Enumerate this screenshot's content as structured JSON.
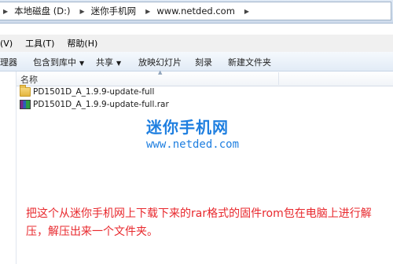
{
  "address": {
    "arrow_icon": "triangle-right",
    "crumbs": [
      "本地磁盘 (D:)",
      "迷你手机网",
      "www.netded.com"
    ]
  },
  "menu": {
    "items": [
      "(V)",
      "工具(T)",
      "帮助(H)"
    ]
  },
  "toolbar": {
    "organize": "理器",
    "include_in_library": "包含到库中",
    "share": "共享",
    "slideshow": "放映幻灯片",
    "burn": "刻录",
    "new_folder": "新建文件夹"
  },
  "columns": {
    "name": "名称"
  },
  "files": [
    {
      "name": "PD1501D_A_1.9.9-update-full",
      "type": "folder",
      "icon": "folder-icon"
    },
    {
      "name": "PD1501D_A_1.9.9-update-full.rar",
      "type": "rar",
      "icon": "winrar-archive-icon"
    }
  ],
  "watermark": {
    "logo": "迷你手机网",
    "url": "www.netded.com"
  },
  "note": "把这个从迷你手机网上下载下来的rar格式的固件rom包在电脑上进行解压，解压出来一个文件夹。",
  "colors": {
    "watermark": "#1f7fe0",
    "note": "#e8282d"
  }
}
